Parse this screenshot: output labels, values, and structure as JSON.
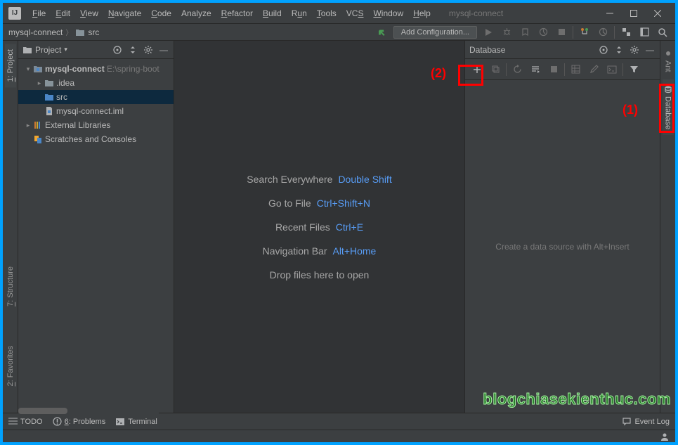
{
  "menu": {
    "file": "File",
    "edit": "Edit",
    "view": "View",
    "navigate": "Navigate",
    "code": "Code",
    "analyze": "Analyze",
    "refactor": "Refactor",
    "build": "Build",
    "run": "Run",
    "tools": "Tools",
    "vcs": "VCS",
    "window": "Window",
    "help": "Help"
  },
  "title": "mysql-connect",
  "breadcrumb": {
    "project": "mysql-connect",
    "folder": "src"
  },
  "navbar": {
    "add_config": "Add Configuration..."
  },
  "left_tabs": {
    "project": "1: Project",
    "structure": "7: Structure",
    "favorites": "2: Favorites"
  },
  "project_panel": {
    "title": "Project"
  },
  "tree": {
    "root": "mysql-connect",
    "root_path": "E:\\spring-boot",
    "idea": ".idea",
    "src": "src",
    "iml": "mysql-connect.iml",
    "external": "External Libraries",
    "scratches": "Scratches and Consoles"
  },
  "editor_hints": {
    "search_label": "Search Everywhere",
    "search_key": "Double Shift",
    "goto_label": "Go to File",
    "goto_key": "Ctrl+Shift+N",
    "recent_label": "Recent Files",
    "recent_key": "Ctrl+E",
    "navbar_label": "Navigation Bar",
    "navbar_key": "Alt+Home",
    "drop": "Drop files here to open"
  },
  "database": {
    "title": "Database",
    "placeholder": "Create a data source with Alt+Insert"
  },
  "right_tabs": {
    "ant": "Ant",
    "database": "Database"
  },
  "status": {
    "todo": "TODO",
    "problems": "6: Problems",
    "terminal": "Terminal",
    "event_log": "Event Log"
  },
  "annotations": {
    "one": "(1)",
    "two": "(2)"
  },
  "watermark": "blogchiasekienthuc.com"
}
